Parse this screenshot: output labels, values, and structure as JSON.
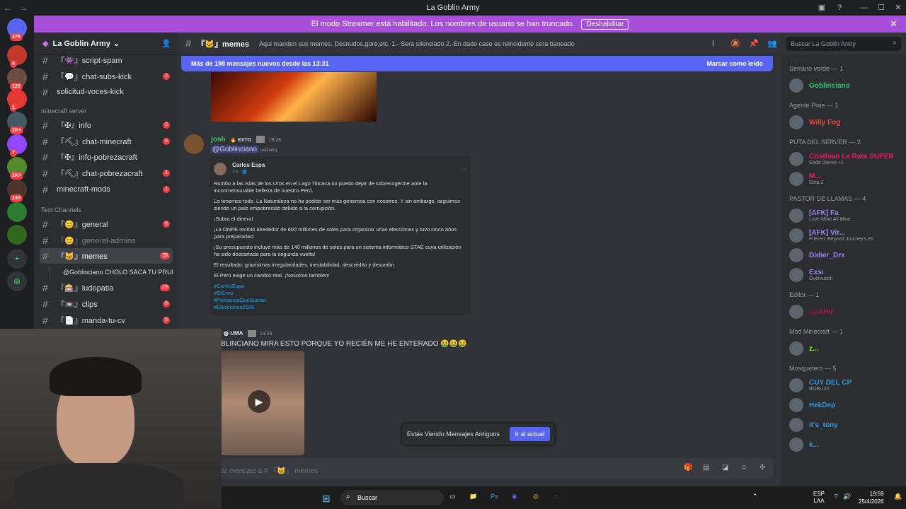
{
  "window": {
    "title": "La Goblin Army"
  },
  "banner": {
    "text": "El modo Streamer está habilitado. Los nombres de usuario se han truncado.",
    "button": "Deshabilitar"
  },
  "servers": [
    {
      "badge": "479",
      "color": "#5865f2"
    },
    {
      "badge": "4",
      "color": "#c0392b"
    },
    {
      "badge": "123",
      "color": "#6d4c41"
    },
    {
      "badge": "1",
      "color": "#e53935"
    },
    {
      "badge": "1K+",
      "color": "#455a64"
    },
    {
      "badge": "7",
      "color": "#9146ff"
    },
    {
      "badge": "1K+",
      "color": "#558b2f"
    },
    {
      "badge": "130",
      "color": "#4e342e"
    },
    {
      "badge": "",
      "color": "#2e7d32"
    },
    {
      "badge": "",
      "color": "#33691e"
    }
  ],
  "sidebar": {
    "server_name": "La Goblin Army",
    "categories": {
      "minecraft": "minecraft server",
      "text": "Text Channels"
    },
    "channels_top": [
      {
        "name": "『👾』script-spam",
        "count": ""
      },
      {
        "name": "『💬』chat-subs-kick",
        "count": "2"
      },
      {
        "name": "solicitud-voces-kick",
        "count": ""
      }
    ],
    "channels_mc": [
      {
        "name": "『✠』info",
        "count": "2"
      },
      {
        "name": "『⛏』chat-minecraft",
        "count": "6"
      },
      {
        "name": "『✠』info-pobrezacraft",
        "count": ""
      },
      {
        "name": "『⛏』chat-pobrezacraft",
        "count": "1"
      },
      {
        "name": "minecraft-mods",
        "count": "1"
      }
    ],
    "channels_text": [
      {
        "name": "『😊』general",
        "count": "6"
      },
      {
        "name": "『😊』general-admins",
        "count": ""
      },
      {
        "name": "『🐱』memes",
        "count": "39"
      },
      {
        "name": "@Goblinciano CHOLO SACA TU PRUE...",
        "count": ""
      },
      {
        "name": "『🎰』ludopatia",
        "count": "15"
      },
      {
        "name": "『📼』clips",
        "count": "6"
      },
      {
        "name": "『📄』manda-tu-cv",
        "count": "5"
      }
    ]
  },
  "channel_header": {
    "name": "『🐱』memes",
    "topic": "Aqui manden sus memes. Desnudos,gore,etc. 1.- Sera silenciado 2.-En dado caso es reincidente sera baneado",
    "search_placeholder": "Buscar La Goblin Army"
  },
  "new_messages": {
    "text": "Más de 198 mensajes nuevos desde las 13:31",
    "action": "Marcar como leído"
  },
  "message1": {
    "author": "josh",
    "tag": "EXTO",
    "time": "19:28",
    "mention": "@Goblinciano",
    "edited": "(editado)",
    "embed": {
      "author": "Carlos Espa",
      "meta": "7 h · ",
      "paragraphs": [
        "Rumbo a las Islas de los Uros en el Lago Titicaca no puedo dejar de sobrecogerme ante la inconmensurable belleza de nuestro Perú.",
        "Lo tenemos todo. La Naturaleza no ha podido ser más generosa con nosotros. Y  sin embargo, seguimos siendo un país empobrecido debido a la corrupción.",
        "¡Sobra el dinero!",
        "¡La ONPE recibió alrededor de 600 millones de soles para organizar unas elecciones y tuvo cinco años para prepararlas!",
        "¡Su presupuesto incluyó más de 140 millones de soles para un sistema informático STAE cuya utilización ha sido descartada para la segunda vuelta!",
        "El resultado: gravísimas irregularidades, inestabilidad, descrédito y desunión.",
        "El Perú exige un cambio real. ¡Nosotros también!"
      ],
      "hashtags": [
        "#CarlosEspá",
        "#SíCreo",
        "#PeruanosQueSuman",
        "#Elecciones2026"
      ]
    }
  },
  "message2": {
    "tag": "UMA",
    "time": "19:28",
    "text": "BLINCIANO MIRA ESTO PORQUE YO RECIÉN ME HE ENTERADO"
  },
  "old_messages": {
    "text": "Estás Viendo Mensajes Antiguos",
    "button": "Ir al actual"
  },
  "input": {
    "placeholder": "iar mensaje a # 『🐱』 memes"
  },
  "members": [
    {
      "category": "Serrano verde — 1",
      "users": [
        {
          "name": "Goblinciano",
          "status": "",
          "color": "#2dc770"
        }
      ]
    },
    {
      "category": "Agente Pixie — 1",
      "users": [
        {
          "name": "Willy Fog",
          "status": "",
          "color": "#e74c3c"
        }
      ]
    },
    {
      "category": "PUTA DEL SERVER — 2",
      "users": [
        {
          "name": "Cristhian La Rata SUPER",
          "status": "Soda Stereo +1",
          "color": "#e91e63"
        },
        {
          "name": "M...",
          "status": "Dota 2",
          "color": "#e91e63"
        }
      ]
    },
    {
      "category": "PASTOR DE LLAMAS — 4",
      "users": [
        {
          "name": "[AFK] Fa",
          "status": "Love Mine All Mine",
          "color": "#9b84ee"
        },
        {
          "name": "[AFK] Vir...",
          "status": "Frieren: Beyond Journey's En",
          "color": "#9b84ee"
        },
        {
          "name": "Didier_Drx",
          "status": "",
          "color": "#9b84ee"
        },
        {
          "name": "Exsi",
          "status": "Overwatch",
          "color": "#9b84ee"
        }
      ]
    },
    {
      "category": "Editor — 1",
      "users": [
        {
          "name": "¡¡¡¡AHV",
          "status": "",
          "color": "#ad1457"
        }
      ]
    },
    {
      "category": "Mod Minecraft — 1",
      "users": [
        {
          "name": "z...",
          "status": "",
          "color": "#7fff00"
        }
      ]
    },
    {
      "category": "Mosquetero — 5",
      "users": [
        {
          "name": "CUY DEL CP",
          "status": "ROBLOX",
          "color": "#3498db"
        },
        {
          "name": "HekDep",
          "status": "",
          "color": "#3498db"
        },
        {
          "name": "it's_tony",
          "status": "",
          "color": "#3498db"
        },
        {
          "name": "k...",
          "status": "",
          "color": "#3498db"
        }
      ]
    }
  ],
  "taskbar": {
    "search": "Buscar",
    "lang": "ESP",
    "lang2": "LAA",
    "time": "19:59",
    "date": "25/4/2026"
  }
}
